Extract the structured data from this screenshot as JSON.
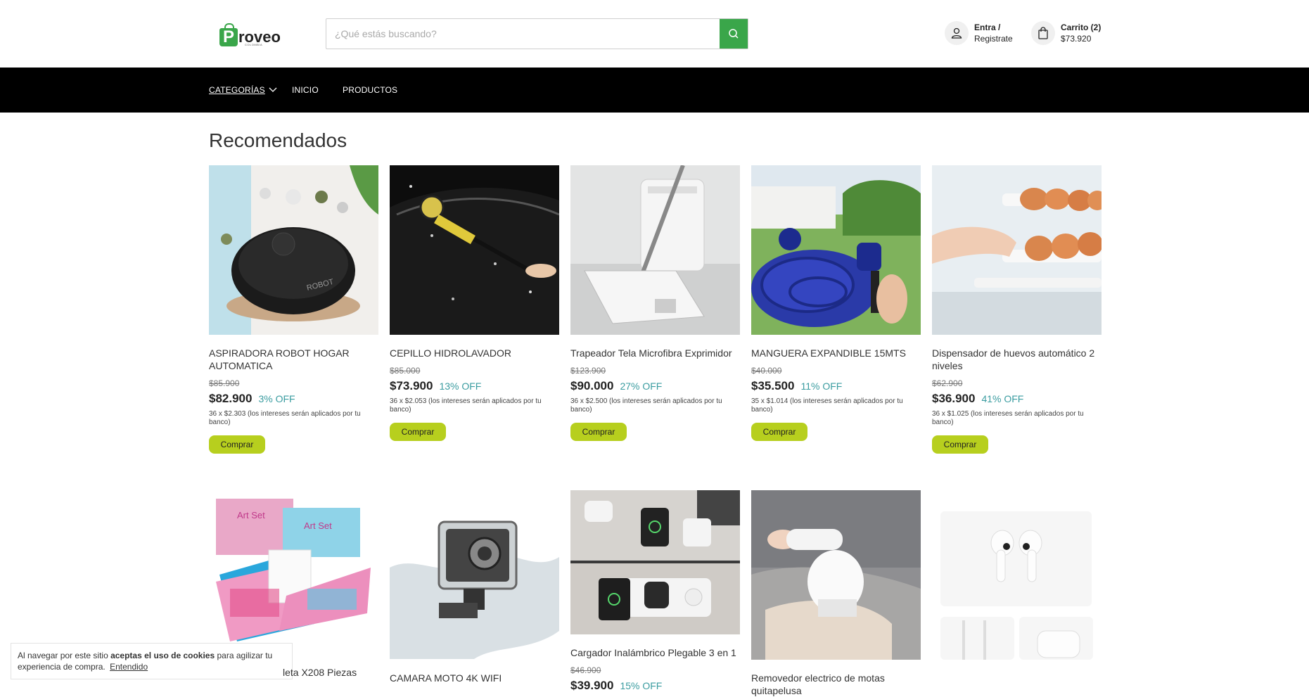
{
  "header": {
    "logo_letter": "P",
    "logo_text": "roveo",
    "logo_sub": "COLOMBIA",
    "search_placeholder": "¿Qué estás buscando?",
    "account_line1": "Entra /",
    "account_line2": "Registrate",
    "cart_line1": "Carrito (2)",
    "cart_line2": "$73.920"
  },
  "nav": {
    "categories": "CATEGORÍAS",
    "home": "INICIO",
    "products": "PRODUCTOS"
  },
  "section": {
    "title": "Recomendados"
  },
  "products": [
    {
      "name": "ASPIRADORA ROBOT HOGAR AUTOMATICA",
      "old_price": "$85.900",
      "price": "$82.900",
      "off": "3% OFF",
      "install": "36 x $2.303 (los intereses serán aplicados por tu banco)",
      "buy": "Comprar"
    },
    {
      "name": "CEPILLO HIDROLAVADOR",
      "old_price": "$85.000",
      "price": "$73.900",
      "off": "13% OFF",
      "install": "36 x $2.053 (los intereses serán aplicados por tu banco)",
      "buy": "Comprar"
    },
    {
      "name": "Trapeador Tela Microfibra Exprimidor",
      "old_price": "$123.900",
      "price": "$90.000",
      "off": "27% OFF",
      "install": "36 x $2.500 (los intereses serán aplicados por tu banco)",
      "buy": "Comprar"
    },
    {
      "name": "MANGUERA EXPANDIBLE 15MTS",
      "old_price": "$40.000",
      "price": "$35.500",
      "off": "11% OFF",
      "install": "35 x $1.014 (los intereses serán aplicados por tu banco)",
      "buy": "Comprar"
    },
    {
      "name": "Dispensador de huevos automático 2 niveles",
      "old_price": "$62.900",
      "price": "$36.900",
      "off": "41% OFF",
      "install": "36 x $1.025 (los intereses serán aplicados por tu banco)",
      "buy": "Comprar"
    },
    {
      "name": "leta X208 Piezas"
    },
    {
      "name": "CAMARA MOTO 4K WIFI"
    },
    {
      "name": "Cargador Inalámbrico Plegable 3 en 1",
      "old_price": "$46.900",
      "price": "$39.900",
      "off": "15% OFF"
    },
    {
      "name": "Removedor electrico de motas quitapelusa"
    }
  ],
  "cookie": {
    "text1": "Al navegar por este sitio ",
    "bold": "aceptas el uso de cookies",
    "text2": " para agilizar tu experiencia de compra.",
    "link": "Entendido"
  },
  "colors": {
    "brand_green": "#3aa64a",
    "buy_button": "#b7cf1e",
    "discount": "#3a9ca0",
    "nav_bg": "#000000"
  },
  "icons": [
    "shopping-bag-logo",
    "search-icon",
    "user-icon",
    "cart-bag-icon",
    "chevron-down-icon"
  ]
}
